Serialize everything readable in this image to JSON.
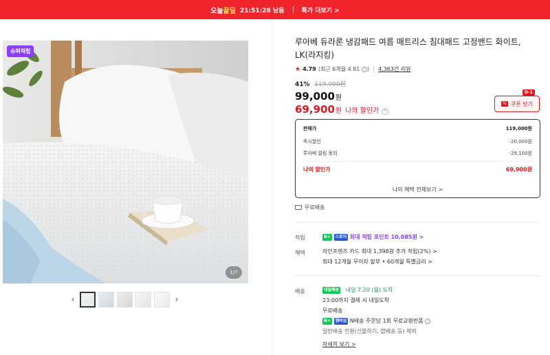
{
  "banner": {
    "logo_main": "오늘",
    "logo_accent": "끝딜",
    "countdown": "21:51:28",
    "countdown_suffix": "남음",
    "more_label": "특가 더보기 >"
  },
  "gallery": {
    "badge": "슈퍼적립",
    "counter": "1/7",
    "prev_icon": "chevron-left-icon",
    "next_icon": "chevron-right-icon",
    "thumb_count": 5,
    "selected_thumb": 1
  },
  "product": {
    "title": "루아베 듀라론 냉감패드 여름 매트리스 침대패드 고정밴드 화이트, LK(라지킹)",
    "rating": "4.79",
    "rating_recent": "(최근 6개월 4.81",
    "reviews": "4,363건 리뷰",
    "discount_pct": "41%",
    "original_price": "119,000원",
    "price": "99,000",
    "price_unit": "원",
    "my_price": "69,900",
    "my_price_unit": "원",
    "my_price_label": "나의 할인가"
  },
  "coupon": {
    "dday": "D-1",
    "label": "쿠폰 받기"
  },
  "price_breakdown": {
    "rows": [
      {
        "label": "판매가",
        "value": "119,000원"
      },
      {
        "label": "즉시할인",
        "value": "-20,000원"
      },
      {
        "label": "루아베 알림 동의",
        "value": "-29,100원"
      }
    ],
    "total_label": "나의 할인가",
    "total_value": "69,900원",
    "view_all": "나의 혜택 전체보기 >"
  },
  "shipping_summary": "무료배송",
  "points": {
    "label": "적립",
    "badge": "N+",
    "badge2": "스토어",
    "text": "최대 적립 포인트 10,085원 >"
  },
  "benefits": {
    "label": "혜택",
    "line1": "라인프렌즈 카드 최대 1,398원 추가 적립(2%) >",
    "line2": "최대 12개월 무이자 할부 • 60개월 특별금리 >"
  },
  "delivery": {
    "label": "배송",
    "badge": "내일배송",
    "arrival": "· 내일 7.20 (월) 도착",
    "cutoff": "23:00까지 결제 시 내일도착",
    "fee": "무료배송",
    "nbadge": "N+",
    "nbadge2": "멤버십",
    "exchange": "N배송 주문당 1회 무료교환반품",
    "note": "일반배송 전환(선물하기, 합배송 등) 제외",
    "more": "자세히 보기 >"
  },
  "colors": {
    "accent_red": "#e0191f",
    "banner_red": "#f0242a",
    "points_purple": "#8a3ff2",
    "delivery_green": "#17a34a"
  }
}
